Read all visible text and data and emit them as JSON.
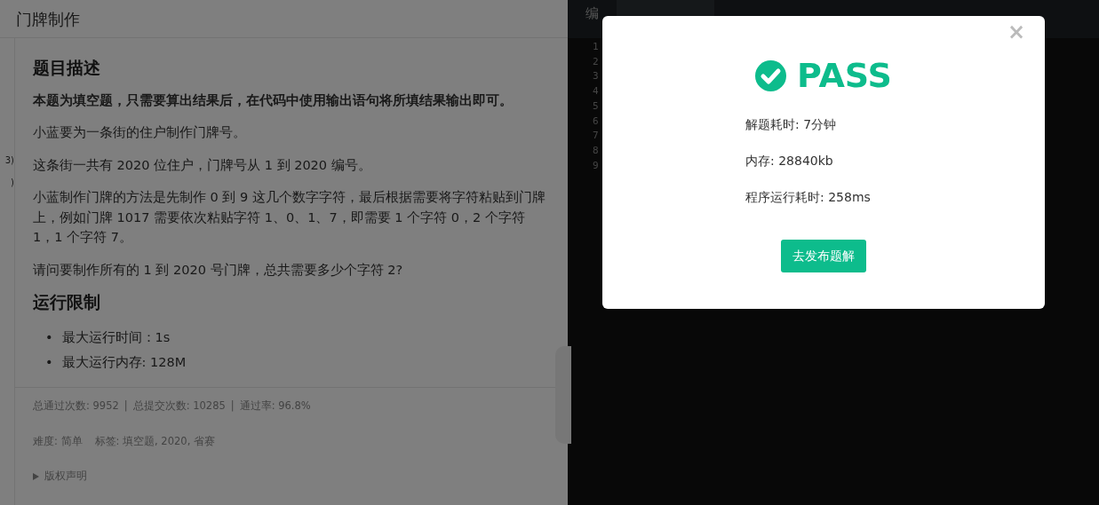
{
  "problem": {
    "title": "门牌制作",
    "sidebar_fragments": [
      "3)",
      ")"
    ],
    "sections": [
      {
        "heading": "题目描述",
        "paragraphs": [
          {
            "text": "本题为填空题，只需要算出结果后，在代码中使用输出语句将所填结果输出即可。",
            "bold": true
          },
          {
            "text": "小蓝要为一条街的住户制作门牌号。",
            "bold": false
          },
          {
            "text": "这条街一共有 2020 位住户，门牌号从 1 到 2020 编号。",
            "bold": false
          },
          {
            "text": "小蓝制作门牌的方法是先制作 0 到 9 这几个数字字符，最后根据需要将字符粘贴到门牌上，例如门牌 1017 需要依次粘贴字符 1、0、1、7，即需要 1 个字符 0，2 个字符 1，1 个字符 7。",
            "bold": false
          },
          {
            "text": "请问要制作所有的 1 到 2020 号门牌，总共需要多少个字符 2?",
            "bold": false
          }
        ]
      },
      {
        "heading": "运行限制",
        "bullet_marker": "•",
        "bullets": [
          "最大运行时间：1s",
          "最大运行内存: 128M"
        ]
      }
    ],
    "stats": [
      "总通过次数: 9952",
      "总提交次数: 10285",
      "通过率: 96.8%"
    ],
    "stats_separator": "|",
    "meta": [
      "难度: 简单",
      "标签: 填空题, 2020, 省赛"
    ],
    "copyright": {
      "label": "版权声明",
      "expanded": false
    }
  },
  "editor": {
    "language_label": "编",
    "line_numbers": [
      "1",
      "2",
      "3",
      "4",
      "5",
      "6",
      "7",
      "8",
      "9"
    ]
  },
  "modal": {
    "result": "PASS",
    "details": [
      "解题耗时: 7分钟",
      "内存: 28840kb",
      "程序运行耗时: 258ms"
    ],
    "button": "去发布题解",
    "close": "×"
  }
}
